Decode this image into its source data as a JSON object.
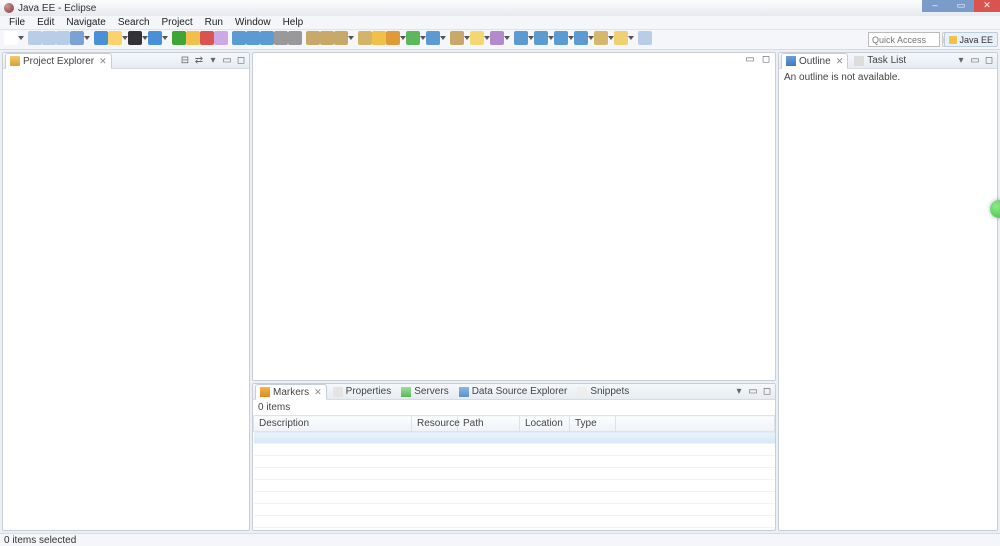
{
  "window": {
    "title": "Java EE - Eclipse"
  },
  "menus": [
    "File",
    "Edit",
    "Navigate",
    "Search",
    "Project",
    "Run",
    "Window",
    "Help"
  ],
  "toolbar": {
    "quick_access_placeholder": "Quick Access",
    "perspective_label": "Java EE"
  },
  "views": {
    "project_explorer": {
      "title": "Project Explorer"
    },
    "outline": {
      "title": "Outline",
      "body": "An outline is not available."
    },
    "tasklist": {
      "title": "Task List"
    }
  },
  "bottom": {
    "tabs": {
      "markers": "Markers",
      "properties": "Properties",
      "servers": "Servers",
      "data_source_explorer": "Data Source Explorer",
      "snippets": "Snippets"
    },
    "items_count": "0 items",
    "columns": {
      "description": "Description",
      "resource": "Resource",
      "path": "Path",
      "location": "Location",
      "type": "Type"
    }
  },
  "statusbar": {
    "text": "0 items selected"
  },
  "toolbar_icons": {
    "colors": [
      "#fff",
      "#b8cde6",
      "#b8cde6",
      "#b8cde6",
      "#7aa2d4",
      "#4a90d9",
      "#fcd26a",
      "#333",
      "#4a90d9",
      "#3fa535",
      "#f0c04a",
      "#d9534f",
      "#cda8e6",
      "#5c9bd1",
      "#5c9bd1",
      "#5c9bd1",
      "#999",
      "#999",
      "#c8a96a",
      "#c8a96a",
      "#c8a96a",
      "#d4b46a",
      "#f0c04a",
      "#e09a3a",
      "#5cb85c",
      "#5c9bd1",
      "#c8a96a",
      "#f5d772",
      "#b38bcc",
      "#5c9bd1",
      "#5c9bd1",
      "#5c9bd1",
      "#5c9bd1",
      "#d6b86a",
      "#f0d070",
      "#b8cde6"
    ]
  }
}
